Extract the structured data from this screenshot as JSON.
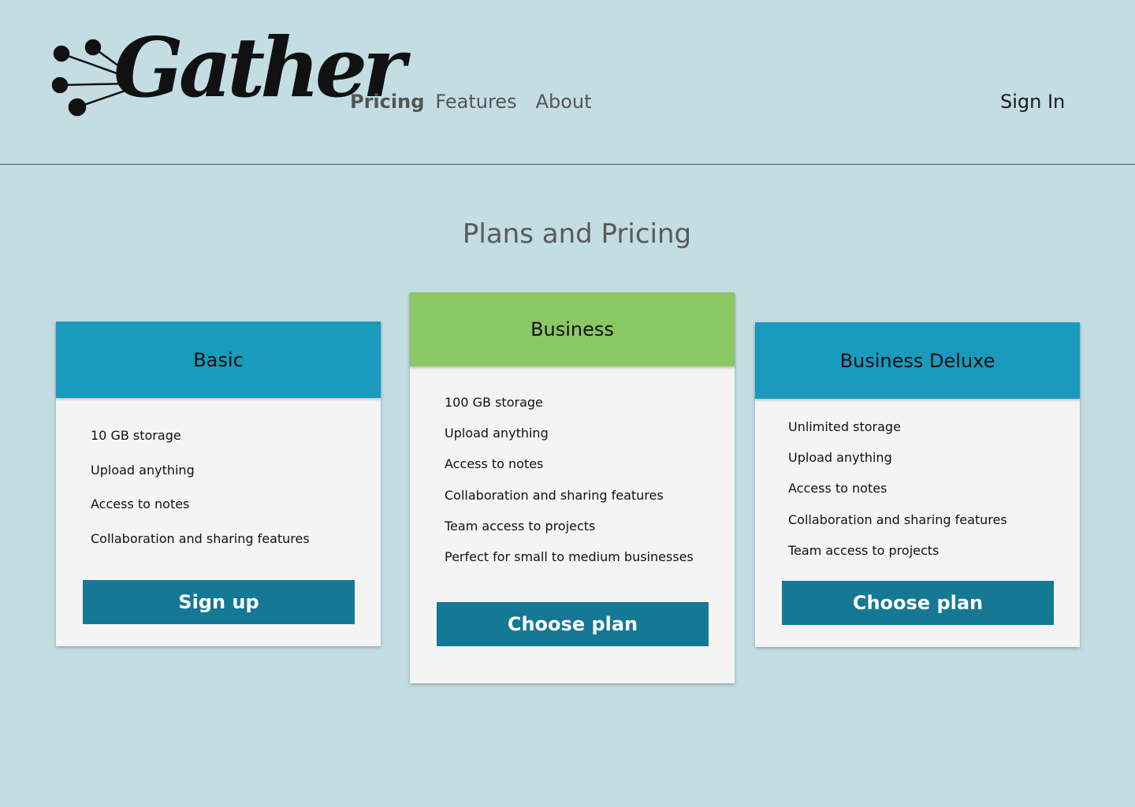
{
  "header": {
    "logo_text": "Gather",
    "nav": [
      {
        "label": "Pricing",
        "active": true
      },
      {
        "label": "Features",
        "active": false
      },
      {
        "label": "About",
        "active": false
      }
    ],
    "signin_label": "Sign In"
  },
  "main": {
    "title": "Plans and Pricing",
    "plans": [
      {
        "name": "Basic",
        "features": [
          "10 GB storage",
          "Upload anything",
          "Access to notes",
          "Collaboration and sharing features"
        ],
        "cta": "Sign up"
      },
      {
        "name": "Business",
        "features": [
          "100 GB storage",
          "Upload anything",
          "Access to notes",
          "Collaboration and sharing features",
          "Team access to projects",
          "Perfect for small to medium businesses"
        ],
        "cta": "Choose plan"
      },
      {
        "name": "Business Deluxe",
        "features": [
          "Unlimited storage",
          "Upload anything",
          "Access to notes",
          "Collaboration and sharing features",
          "Team access to projects"
        ],
        "cta": "Choose plan"
      }
    ]
  },
  "colors": {
    "background": "#c3dde3",
    "plan_header": "#1a9abd",
    "featured_header": "#8bc764",
    "button": "#157894",
    "card": "#f4f4f4"
  }
}
